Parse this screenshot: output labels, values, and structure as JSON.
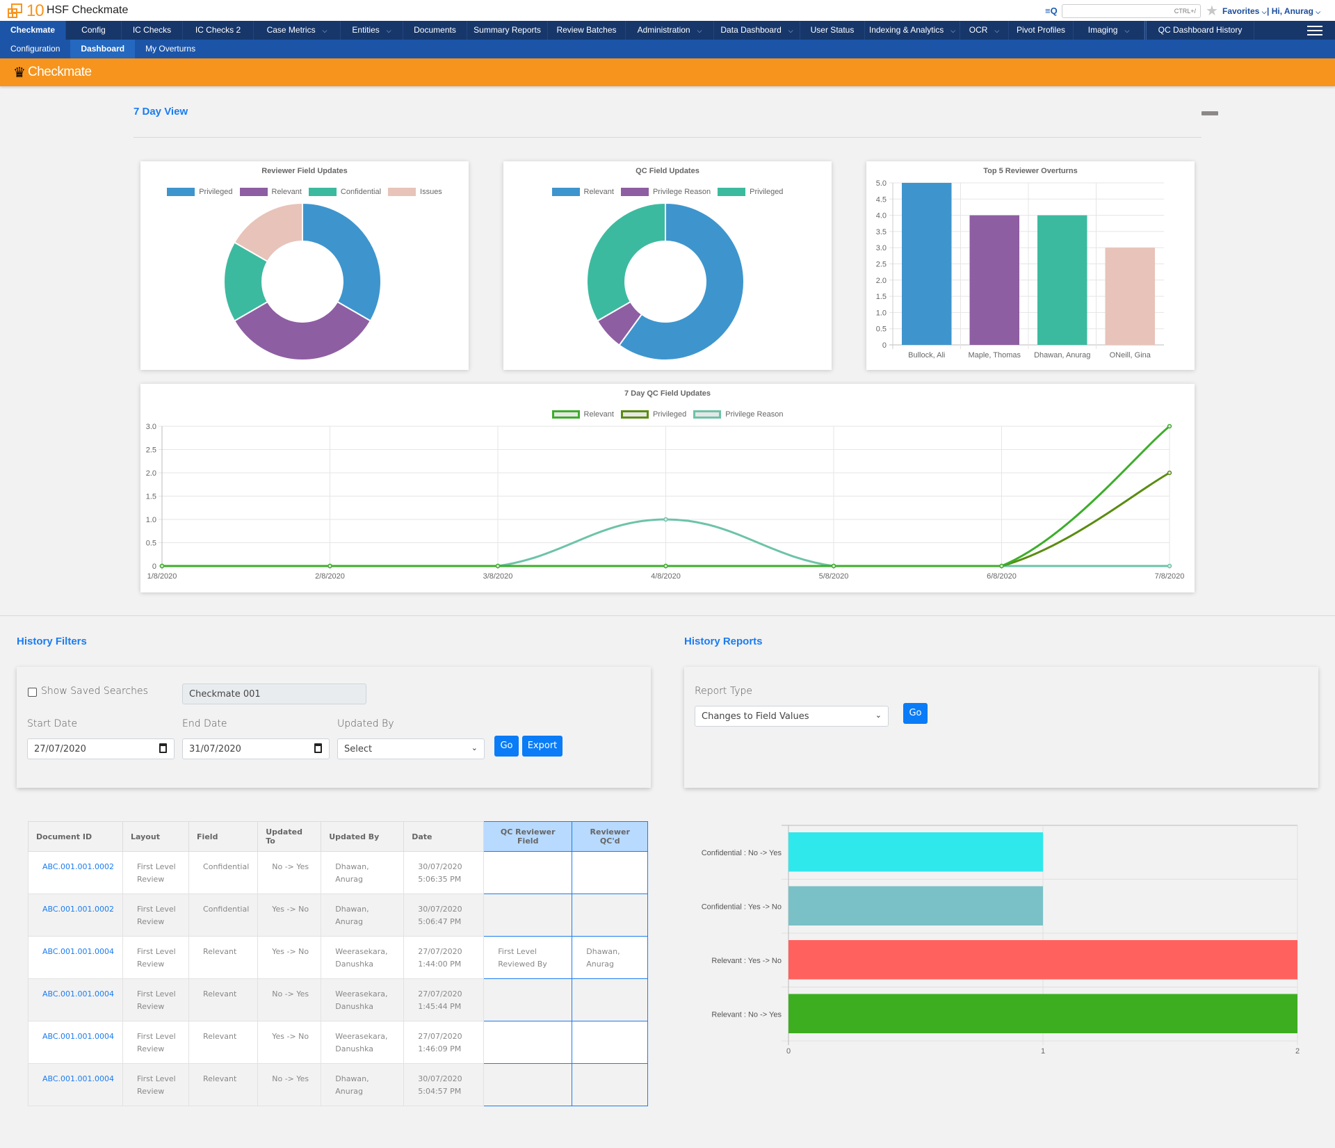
{
  "header": {
    "logo_number": "10",
    "app_title": "HSF Checkmate",
    "search_placeholder": "CTRL+/",
    "favorites_label": "Favorites",
    "user_greeting": "| Hi, Anurag"
  },
  "nav": {
    "items": [
      {
        "label": "Checkmate",
        "active": true,
        "dropdown": false
      },
      {
        "label": "Config",
        "dropdown": false
      },
      {
        "label": "IC Checks",
        "dropdown": false
      },
      {
        "label": "IC Checks 2",
        "dropdown": false
      },
      {
        "label": "Case Metrics",
        "dropdown": true
      },
      {
        "label": "Entities",
        "dropdown": true
      },
      {
        "label": "Documents",
        "dropdown": false
      },
      {
        "label": "Summary Reports",
        "dropdown": false
      },
      {
        "label": "Review Batches",
        "dropdown": false
      },
      {
        "label": "Administration",
        "dropdown": true
      },
      {
        "label": "Data Dashboard",
        "dropdown": true
      },
      {
        "label": "User Status",
        "dropdown": false
      },
      {
        "label": "Indexing & Analytics",
        "dropdown": true
      },
      {
        "label": "OCR",
        "dropdown": true
      },
      {
        "label": "Pivot Profiles",
        "dropdown": false
      },
      {
        "label": "Imaging",
        "dropdown": true
      },
      {
        "label": "QC Dashboard History",
        "dropdown": false
      }
    ]
  },
  "subnav": {
    "items": [
      {
        "label": "Configuration"
      },
      {
        "label": "Dashboard",
        "active": true
      },
      {
        "label": "My Overturns"
      }
    ]
  },
  "page": {
    "title": "Checkmate",
    "seven_day_title": "7 Day View",
    "history_filters_title": "History Filters",
    "history_reports_title": "History Reports"
  },
  "filters": {
    "show_saved_label": "Show Saved Searches",
    "saved_search_value": "Checkmate 001",
    "start_date_label": "Start Date",
    "start_date_value": "27/07/2020",
    "end_date_label": "End Date",
    "end_date_value": "31/07/2020",
    "updated_by_label": "Updated By",
    "updated_by_value": "Select",
    "go_label": "Go",
    "export_label": "Export"
  },
  "reports": {
    "report_type_label": "Report Type",
    "report_type_value": "Changes to Field Values",
    "go_label": "Go"
  },
  "table": {
    "headers": [
      "Document ID",
      "Layout",
      "Field",
      "Updated To",
      "Updated By",
      "Date",
      "QC Reviewer Field",
      "Reviewer QC'd"
    ],
    "rows": [
      {
        "doc_id": "ABC.001.001.0002",
        "layout_1": "First Level",
        "layout_2": "Review",
        "field": "Confidential",
        "updated_to": "No -> Yes",
        "by_1": "Dhawan,",
        "by_2": "Anurag",
        "date_1": "30/07/2020",
        "date_2": "5:06:35 PM",
        "qc_1": "",
        "qc_2": "",
        "rq_1": "",
        "rq_2": ""
      },
      {
        "doc_id": "ABC.001.001.0002",
        "layout_1": "First Level",
        "layout_2": "Review",
        "field": "Confidential",
        "updated_to": "Yes -> No",
        "by_1": "Dhawan,",
        "by_2": "Anurag",
        "date_1": "30/07/2020",
        "date_2": "5:06:47 PM",
        "qc_1": "",
        "qc_2": "",
        "rq_1": "",
        "rq_2": ""
      },
      {
        "doc_id": "ABC.001.001.0004",
        "layout_1": "First Level",
        "layout_2": "Review",
        "field": "Relevant",
        "updated_to": "Yes -> No",
        "by_1": "Weerasekara,",
        "by_2": "Danushka",
        "date_1": "27/07/2020",
        "date_2": "1:44:00 PM",
        "qc_1": "First Level",
        "qc_2": "Reviewed By",
        "rq_1": "Dhawan,",
        "rq_2": "Anurag"
      },
      {
        "doc_id": "ABC.001.001.0004",
        "layout_1": "First Level",
        "layout_2": "Review",
        "field": "Relevant",
        "updated_to": "No -> Yes",
        "by_1": "Weerasekara,",
        "by_2": "Danushka",
        "date_1": "27/07/2020",
        "date_2": "1:45:44 PM",
        "qc_1": "",
        "qc_2": "",
        "rq_1": "",
        "rq_2": ""
      },
      {
        "doc_id": "ABC.001.001.0004",
        "layout_1": "First Level",
        "layout_2": "Review",
        "field": "Relevant",
        "updated_to": "Yes -> No",
        "by_1": "Weerasekara,",
        "by_2": "Danushka",
        "date_1": "27/07/2020",
        "date_2": "1:46:09 PM",
        "qc_1": "",
        "qc_2": "",
        "rq_1": "",
        "rq_2": ""
      },
      {
        "doc_id": "ABC.001.001.0004",
        "layout_1": "First Level",
        "layout_2": "Review",
        "field": "Relevant",
        "updated_to": "No -> Yes",
        "by_1": "Dhawan,",
        "by_2": "Anurag",
        "date_1": "30/07/2020",
        "date_2": "5:04:57 PM",
        "qc_1": "",
        "qc_2": "",
        "rq_1": "",
        "rq_2": ""
      }
    ]
  },
  "colors": {
    "nav_bg": "#17376b",
    "subnav_bg": "#1c55a8",
    "orange": "#f7941d",
    "link_blue": "#1a7cf0",
    "button_blue": "#0a7cf7"
  },
  "chart_data": [
    {
      "type": "pie",
      "variant": "doughnut",
      "title": "Reviewer Field Updates",
      "labels": [
        "Privileged",
        "Relevant",
        "Confidential",
        "Issues"
      ],
      "values": [
        2,
        2,
        1,
        1
      ],
      "colors": [
        "#3e95cd",
        "#8e5ea2",
        "#3cba9f",
        "#e8c3b9"
      ],
      "legend": "top"
    },
    {
      "type": "pie",
      "variant": "doughnut",
      "title": "QC Field Updates",
      "labels": [
        "Relevant",
        "Privilege Reason",
        "Privileged"
      ],
      "values": [
        9,
        1,
        5
      ],
      "colors": [
        "#3e95cd",
        "#8e5ea2",
        "#3cba9f"
      ],
      "legend": "top"
    },
    {
      "type": "bar",
      "title": "Top 5 Reviewer Overturns",
      "categories": [
        "Bullock, Ali",
        "Maple, Thomas",
        "Dhawan, Anurag",
        "ONeill, Gina"
      ],
      "values": [
        5,
        4,
        4,
        3
      ],
      "colors": [
        "#3e95cd",
        "#8e5ea2",
        "#3cba9f",
        "#e8c3b9"
      ],
      "ylim": [
        0,
        5
      ],
      "yticks": [
        "0",
        "0.5",
        "1.0",
        "1.5",
        "2.0",
        "2.5",
        "3.0",
        "3.5",
        "4.0",
        "4.5",
        "5.0"
      ],
      "grid": true
    },
    {
      "type": "line",
      "title": "7 Day QC Field Updates",
      "x": [
        "1/8/2020",
        "2/8/2020",
        "3/8/2020",
        "4/8/2020",
        "5/8/2020",
        "6/8/2020",
        "7/8/2020"
      ],
      "series": [
        {
          "name": "Relevant",
          "values": [
            0,
            0,
            0,
            0,
            0,
            0,
            3
          ],
          "color": "#3cae2a"
        },
        {
          "name": "Privileged",
          "values": [
            0,
            0,
            0,
            0,
            0,
            0,
            2
          ],
          "color": "#5a8c10"
        },
        {
          "name": "Privilege Reason",
          "values": [
            0,
            0,
            0,
            1,
            0,
            0,
            0
          ],
          "color": "#6cc3a8"
        }
      ],
      "ylim": [
        0,
        3
      ],
      "yticks": [
        "0",
        "0.5",
        "1.0",
        "1.5",
        "2.0",
        "2.5",
        "3.0"
      ],
      "legend": "top",
      "grid": true
    },
    {
      "type": "bar",
      "orientation": "horizontal",
      "title": "",
      "categories": [
        "Confidential : No -> Yes",
        "Confidential : Yes -> No",
        "Relevant : Yes -> No",
        "Relevant : No -> Yes"
      ],
      "values": [
        1,
        1,
        2,
        2
      ],
      "colors": [
        "#2ee8ec",
        "#79c1c6",
        "#ff625e",
        "#3dae20"
      ],
      "xlim": [
        0,
        2
      ],
      "xticks": [
        "0",
        "1",
        "2"
      ],
      "grid": true
    }
  ]
}
